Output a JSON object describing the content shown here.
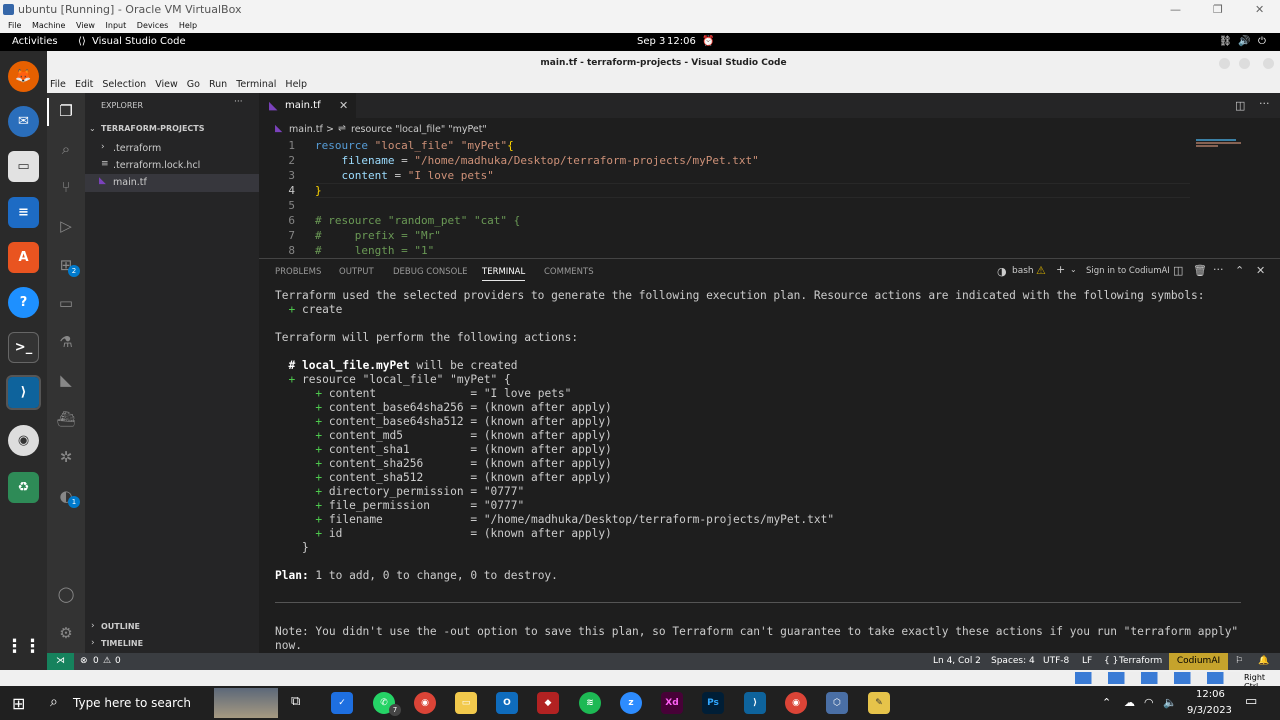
{
  "vbox": {
    "title": "ubuntu [Running] - Oracle VM VirtualBox",
    "menu": [
      "File",
      "Machine",
      "View",
      "Input",
      "Devices",
      "Help"
    ],
    "status_right": "Right Ctrl"
  },
  "gnome": {
    "activities": "Activities",
    "app": "Visual Studio Code",
    "date": "Sep 3",
    "time": "12:06"
  },
  "vscode": {
    "title": "main.tf - terraform-projects - Visual Studio Code",
    "menu": [
      "File",
      "Edit",
      "Selection",
      "View",
      "Go",
      "Run",
      "Terminal",
      "Help"
    ],
    "explorer": {
      "header": "EXPLORER",
      "folder": "TERRAFORM-PROJECTS",
      "items": [
        ".terraform",
        ".terraform.lock.hcl",
        "main.tf"
      ],
      "outline": "OUTLINE",
      "timeline": "TIMELINE"
    },
    "tab": "main.tf",
    "breadcrumb": {
      "file": "main.tf",
      "sep": ">",
      "symbol": "resource \"local_file\" \"myPet\""
    },
    "code": {
      "line_numbers": [
        "1",
        "2",
        "3",
        "4",
        "5",
        "6",
        "7",
        "8"
      ],
      "lines": [
        "resource \"local_file\" \"myPet\"{",
        "    filename = \"/home/madhuka/Desktop/terraform-projects/myPet.txt\"",
        "    content = \"I love pets\"",
        "}",
        "",
        "# resource \"random_pet\" \"cat\" {",
        "#     prefix = \"Mr\"",
        "#     length = \"1\""
      ]
    },
    "panel": {
      "tabs": [
        "PROBLEMS",
        "OUTPUT",
        "DEBUG CONSOLE",
        "TERMINAL",
        "COMMENTS"
      ],
      "active_tab": "TERMINAL",
      "shell": "bash",
      "signin": "Sign in to CodiumAI"
    },
    "terminal": [
      "Terraform used the selected providers to generate the following execution plan. Resource actions are indicated with the following symbols:",
      "  + create",
      "",
      "Terraform will perform the following actions:",
      "",
      "  # local_file.myPet will be created",
      "  + resource \"local_file\" \"myPet\" {",
      "      + content              = \"I love pets\"",
      "      + content_base64sha256 = (known after apply)",
      "      + content_base64sha512 = (known after apply)",
      "      + content_md5          = (known after apply)",
      "      + content_sha1         = (known after apply)",
      "      + content_sha256       = (known after apply)",
      "      + content_sha512       = (known after apply)",
      "      + directory_permission = \"0777\"",
      "      + file_permission      = \"0777\"",
      "      + filename             = \"/home/madhuka/Desktop/terraform-projects/myPet.txt\"",
      "      + id                   = (known after apply)",
      "    }",
      "",
      "Plan: 1 to add, 0 to change, 0 to destroy.",
      "",
      "",
      "",
      "Note: You didn't use the -out option to save this plan, so Terraform can't guarantee to take exactly these actions if you run \"terraform apply\"",
      "now."
    ],
    "status": {
      "errors": "0",
      "warnings": "0",
      "position": "Ln 4, Col 2",
      "spaces": "Spaces: 4",
      "encoding": "UTF-8",
      "eol": "LF",
      "language": "Terraform",
      "codium": "CodiumAI",
      "brackets": "{ }"
    },
    "badges": {
      "extensions": "2",
      "accounts": "1"
    }
  },
  "taskbar": {
    "search_placeholder": "Type here to search",
    "time": "12:06",
    "date": "9/3/2023",
    "whatsapp_badge": "7"
  },
  "colors": {
    "accent": "#007acc",
    "statusbar": "#3a3d41",
    "codium": "#c5a32c"
  }
}
